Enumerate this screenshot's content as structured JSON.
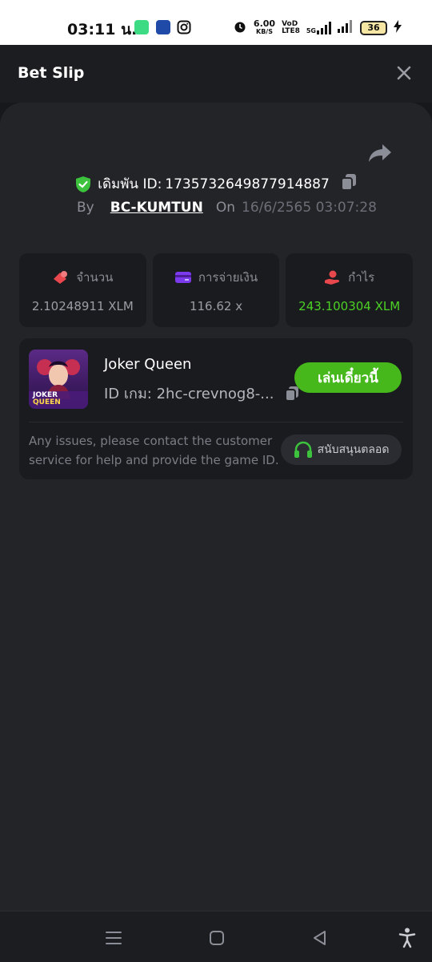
{
  "status_bar": {
    "time": "03:11 น.",
    "speed_value": "6.00",
    "speed_unit": "KB/S",
    "network": "5G",
    "battery": "36"
  },
  "header": {
    "title": "Bet Slip"
  },
  "bet": {
    "id_label": "เดิมพัน ID:",
    "id_value": "1735732649877914887",
    "by_label": "By",
    "user": "BC-KUMTUN",
    "on_label": "On",
    "datetime": "16/6/2565 03:07:28"
  },
  "stats": [
    {
      "label": "จำนวน",
      "value": "2.10248911 XLM",
      "color": "#e8484d"
    },
    {
      "label": "การจ่ายเงิน",
      "value": "116.62 x",
      "color": "#7c3aed"
    },
    {
      "label": "กำไร",
      "value": "243.100304 XLM",
      "color": "#e8484d"
    }
  ],
  "game": {
    "name": "Joker Queen",
    "id_text": "ID เกม: 2hc-crevnog8-...",
    "play_label": "เล่นเดี๋ยวนี้",
    "thumb_text_1": "JOKER",
    "thumb_text_2": "QUEEN",
    "issue_text": "Any issues, please contact the customer service for help and provide the game ID.",
    "support_label": "สนับสนุนตลอด"
  },
  "colors": {
    "accent_green": "#46b81c",
    "profit_green": "#4bd125",
    "shield_green": "#3cc23c"
  }
}
